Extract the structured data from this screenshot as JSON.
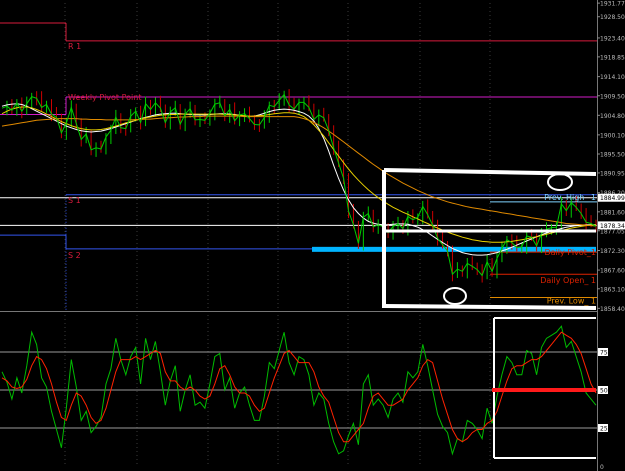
{
  "colors": {
    "background": "#000000",
    "price": "#00cc00",
    "price_dark": "#cc0000",
    "ma_white": "#ffffff",
    "ma_yellow": "#e8d000",
    "ma_orange": "#e08a00",
    "r1": "#d81b3c",
    "weekly_pivot": "#d21cc8",
    "s_level": "#3355ee",
    "cyan": "#00b4ff",
    "prev_high": "#7fd4ff",
    "prev_low": "#e08a00",
    "daily_open": "#dd2200",
    "osc_green": "#00bb00",
    "osc_red": "#ff2200",
    "grid": "#9a9a9a",
    "axis_text": "#bbbbbb"
  },
  "chart_data": [
    {
      "type": "line",
      "panel": "price",
      "ylim": [
        1858.0,
        1931.8
      ],
      "y_ticks": [
        "1931.77",
        "1928.50",
        "1923.40",
        "1918.85",
        "1914.10",
        "1909.50",
        "1904.80",
        "1900.10",
        "1895.50",
        "1890.95",
        "1886.20",
        "1881.60",
        "1877.05",
        "1872.30",
        "1867.60",
        "1863.10",
        "1858.40"
      ],
      "price_tags": [
        {
          "value": 1884.99,
          "label": "1884.99"
        },
        {
          "value": 1878.34,
          "label": "1878.34"
        }
      ],
      "levels": [
        {
          "name": "R 1",
          "value": 1922.7,
          "color": "#d81b3c"
        },
        {
          "name": "Weekly Pivot Point",
          "value": 1909.2,
          "color": "#d21cc8"
        },
        {
          "name": "S 1",
          "value": 1885.7,
          "color": "#3355ee"
        },
        {
          "name": "S 2",
          "value": 1872.7,
          "color": "#3355ee"
        }
      ],
      "labels": {
        "r1": "R 1",
        "weekly_pivot": "Weekly Pivot Point",
        "s1": "S 1",
        "s2": "S 2",
        "prev_high": "Prev. High_ 1",
        "daily_pivot": "Daily Pivot_1",
        "daily_open": "Daily Open_ 1",
        "prev_low": "Prev. Low_ 1"
      },
      "series": [
        {
          "color": "#00cc00",
          "values": [
            1906.5,
            1907.0,
            1906.0,
            1907.8,
            1905.8,
            1907.6,
            1909.3,
            1908.9,
            1906.7,
            1907.4,
            1905.1,
            1904.3,
            1900.6,
            1902.9,
            1906.7,
            1902.8,
            1899.0,
            1900.3,
            1896.5,
            1897.0,
            1896.7,
            1899.6,
            1901.2,
            1904.4,
            1901.8,
            1901.6,
            1904.6,
            1905.8,
            1903.1,
            1907.6,
            1906.2,
            1907.8,
            1906.5,
            1903.1,
            1905.6,
            1906.6,
            1902.7,
            1905.1,
            1906.4,
            1903.7,
            1903.8,
            1903.6,
            1905.3,
            1907.5,
            1907.8,
            1904.7,
            1906.2,
            1903.5,
            1904.9,
            1905.2,
            1904.0,
            1902.6,
            1902.5,
            1904.3,
            1907.2,
            1906.9,
            1908.4,
            1909.8,
            1907.3,
            1906.3,
            1907.9,
            1907.9,
            1906.7,
            1903.8,
            1904.9,
            1904.2,
            1901.1,
            1897.0,
            1893.3,
            1889.6,
            1881.8,
            1878.5,
            1874.0,
            1880.3,
            1881.2,
            1878.0,
            1878.5,
            1878.0,
            1876.6,
            1878.1,
            1878.7,
            1877.6,
            1880.5,
            1879.7,
            1880.3,
            1882.9,
            1880.9,
            1878.4,
            1875.2,
            1873.7,
            1872.2,
            1866.6,
            1867.8,
            1867.3,
            1869.2,
            1868.5,
            1867.7,
            1866.3,
            1869.6,
            1867.3,
            1870.4,
            1872.8,
            1874.9,
            1874.2,
            1873.0,
            1873.2,
            1875.8,
            1875.5,
            1873.4,
            1876.4,
            1877.4,
            1877.8,
            1877.9,
            1883.5,
            1881.9,
            1883.8,
            1882.7,
            1881.2,
            1879.1,
            1878.8,
            1878.1
          ]
        },
        {
          "color": "#ffffff",
          "values": [
            1907.0,
            1907.3,
            1907.5,
            1907.6,
            1907.4,
            1907.0,
            1906.4,
            1905.8,
            1905.2,
            1904.6,
            1904.0,
            1903.4,
            1902.8,
            1902.2,
            1901.8,
            1901.4,
            1901.1,
            1900.9,
            1900.8,
            1900.9,
            1901.0,
            1901.3,
            1901.6,
            1902.0,
            1902.4,
            1902.8,
            1903.2,
            1903.6,
            1904.0,
            1904.3,
            1904.6,
            1904.9,
            1905.1,
            1905.2,
            1905.3,
            1905.3,
            1905.2,
            1905.1,
            1905.0,
            1904.9,
            1904.9,
            1904.9,
            1905.0,
            1905.1,
            1905.2,
            1905.2,
            1905.1,
            1905.0,
            1904.8,
            1904.6,
            1904.5,
            1904.6,
            1904.9,
            1905.3,
            1905.7,
            1906.0,
            1906.2,
            1906.3,
            1906.2,
            1906.0,
            1905.7,
            1905.3,
            1904.6,
            1903.4,
            1901.6,
            1899.2,
            1896.2,
            1892.8,
            1889.6,
            1886.8,
            1884.5,
            1882.6,
            1881.2,
            1880.1,
            1879.3,
            1878.9,
            1878.6,
            1878.5,
            1878.5,
            1878.6,
            1878.7,
            1878.7,
            1878.6,
            1878.3,
            1877.9,
            1877.3,
            1876.6,
            1875.8,
            1875.0,
            1874.2,
            1873.5,
            1872.8,
            1872.3,
            1871.8,
            1871.5,
            1871.3,
            1871.2,
            1871.2,
            1871.3,
            1871.5,
            1871.8,
            1872.2,
            1872.6,
            1873.1,
            1873.6,
            1874.1,
            1874.6,
            1875.1,
            1875.6,
            1876.1,
            1876.5,
            1876.9,
            1877.3,
            1877.6,
            1877.9,
            1878.1,
            1878.3,
            1878.4,
            1878.5,
            1878.5,
            1878.5
          ]
        },
        {
          "color": "#e8d000",
          "values": [
            1905.2,
            1905.8,
            1906.3,
            1906.6,
            1906.8,
            1906.8,
            1906.6,
            1906.2,
            1905.7,
            1905.1,
            1904.5,
            1903.9,
            1903.3,
            1902.8,
            1902.3,
            1901.9,
            1901.6,
            1901.4,
            1901.3,
            1901.3,
            1901.4,
            1901.6,
            1901.9,
            1902.2,
            1902.6,
            1903.0,
            1903.3,
            1903.6,
            1903.9,
            1904.2,
            1904.4,
            1904.6,
            1904.8,
            1904.9,
            1905.0,
            1905.0,
            1905.1,
            1905.1,
            1905.1,
            1905.1,
            1905.1,
            1905.1,
            1905.1,
            1905.1,
            1905.1,
            1905.0,
            1905.0,
            1904.9,
            1904.8,
            1904.7,
            1904.6,
            1904.6,
            1904.7,
            1904.8,
            1905.0,
            1905.2,
            1905.3,
            1905.4,
            1905.4,
            1905.3,
            1905.0,
            1904.5,
            1903.6,
            1902.5,
            1901.2,
            1899.8,
            1898.2,
            1896.6,
            1895.0,
            1893.4,
            1891.9,
            1890.5,
            1889.2,
            1888.0,
            1886.9,
            1885.9,
            1885.0,
            1884.2,
            1883.4,
            1882.7,
            1882.1,
            1881.5,
            1881.0,
            1880.4,
            1879.9,
            1879.3,
            1878.8,
            1878.2,
            1877.7,
            1877.2,
            1876.7,
            1876.3,
            1875.9,
            1875.5,
            1875.2,
            1874.9,
            1874.7,
            1874.5,
            1874.4,
            1874.3,
            1874.3,
            1874.3,
            1874.4,
            1874.5,
            1874.7,
            1874.9,
            1875.1,
            1875.4,
            1875.6,
            1875.9,
            1876.2,
            1876.5,
            1876.8,
            1877.1,
            1877.4,
            1877.7,
            1877.9,
            1878.1,
            1878.3,
            1878.4,
            1878.5
          ]
        },
        {
          "color": "#e08a00",
          "values": [
            1902.2,
            1902.4,
            1902.6,
            1902.8,
            1903.0,
            1903.2,
            1903.4,
            1903.6,
            1903.7,
            1903.8,
            1903.9,
            1904.0,
            1904.0,
            1904.0,
            1904.0,
            1904.0,
            1903.9,
            1903.9,
            1903.8,
            1903.8,
            1903.8,
            1903.7,
            1903.7,
            1903.7,
            1903.7,
            1903.7,
            1903.7,
            1903.8,
            1903.8,
            1903.9,
            1903.9,
            1904.0,
            1904.1,
            1904.2,
            1904.2,
            1904.3,
            1904.4,
            1904.4,
            1904.5,
            1904.5,
            1904.5,
            1904.6,
            1904.6,
            1904.6,
            1904.6,
            1904.6,
            1904.6,
            1904.6,
            1904.6,
            1904.5,
            1904.5,
            1904.5,
            1904.5,
            1904.5,
            1904.5,
            1904.5,
            1904.5,
            1904.5,
            1904.5,
            1904.5,
            1904.3,
            1904.0,
            1903.6,
            1903.1,
            1902.5,
            1901.8,
            1901.0,
            1900.2,
            1899.3,
            1898.4,
            1897.5,
            1896.6,
            1895.7,
            1894.8,
            1893.9,
            1893.0,
            1892.2,
            1891.4,
            1890.6,
            1889.9,
            1889.2,
            1888.5,
            1887.9,
            1887.3,
            1886.7,
            1886.2,
            1885.7,
            1885.2,
            1884.8,
            1884.4,
            1884.0,
            1883.7,
            1883.4,
            1883.1,
            1882.8,
            1882.6,
            1882.4,
            1882.2,
            1882.0,
            1881.8,
            1881.6,
            1881.4,
            1881.2,
            1881.0,
            1880.8,
            1880.6,
            1880.4,
            1880.2,
            1880.0,
            1879.8,
            1879.6,
            1879.4,
            1879.2,
            1879.0,
            1878.8,
            1878.7,
            1878.6,
            1878.5,
            1878.4,
            1878.3,
            1878.2
          ]
        }
      ]
    },
    {
      "type": "line",
      "panel": "oscillator",
      "ylim": [
        0,
        100
      ],
      "y_ticks": [
        {
          "value": 75,
          "label": "75"
        },
        {
          "value": 50,
          "label": "50"
        },
        {
          "value": 25,
          "label": "25"
        }
      ],
      "bottom_tick": "0",
      "series": [
        {
          "color": "#00bb00",
          "values": [
            62,
            55,
            44,
            58,
            48,
            66,
            88,
            80,
            58,
            52,
            36,
            24,
            12,
            38,
            70,
            52,
            30,
            36,
            22,
            26,
            32,
            54,
            64,
            84,
            70,
            60,
            72,
            78,
            54,
            84,
            70,
            82,
            62,
            40,
            56,
            66,
            36,
            50,
            60,
            40,
            42,
            38,
            54,
            72,
            74,
            50,
            58,
            38,
            48,
            52,
            40,
            30,
            30,
            46,
            68,
            64,
            76,
            88,
            68,
            60,
            72,
            70,
            60,
            40,
            48,
            44,
            28,
            16,
            8,
            10,
            20,
            28,
            14,
            54,
            60,
            40,
            44,
            40,
            32,
            44,
            48,
            42,
            62,
            58,
            62,
            80,
            66,
            50,
            34,
            26,
            22,
            8,
            18,
            16,
            30,
            28,
            24,
            18,
            38,
            28,
            46,
            60,
            72,
            68,
            60,
            60,
            76,
            74,
            60,
            78,
            84,
            86,
            88,
            92,
            78,
            82,
            72,
            62,
            48,
            44,
            40
          ]
        },
        {
          "color": "#ff2200",
          "values": [
            58,
            56,
            52,
            51,
            52,
            57,
            66,
            72,
            70,
            64,
            54,
            42,
            32,
            30,
            40,
            48,
            46,
            40,
            32,
            28,
            30,
            38,
            50,
            62,
            70,
            70,
            70,
            72,
            70,
            72,
            74,
            76,
            74,
            62,
            56,
            56,
            52,
            50,
            52,
            50,
            46,
            44,
            46,
            54,
            64,
            66,
            60,
            52,
            48,
            48,
            46,
            40,
            36,
            38,
            48,
            58,
            66,
            74,
            76,
            72,
            68,
            68,
            68,
            62,
            52,
            46,
            42,
            32,
            22,
            16,
            16,
            20,
            24,
            28,
            38,
            46,
            48,
            44,
            40,
            40,
            42,
            44,
            50,
            54,
            58,
            66,
            70,
            68,
            56,
            44,
            34,
            24,
            18,
            16,
            18,
            22,
            24,
            24,
            28,
            30,
            36,
            46,
            56,
            64,
            66,
            66,
            68,
            70,
            70,
            72,
            76,
            80,
            84,
            88,
            86,
            84,
            80,
            74,
            64,
            54,
            48
          ]
        }
      ]
    }
  ]
}
